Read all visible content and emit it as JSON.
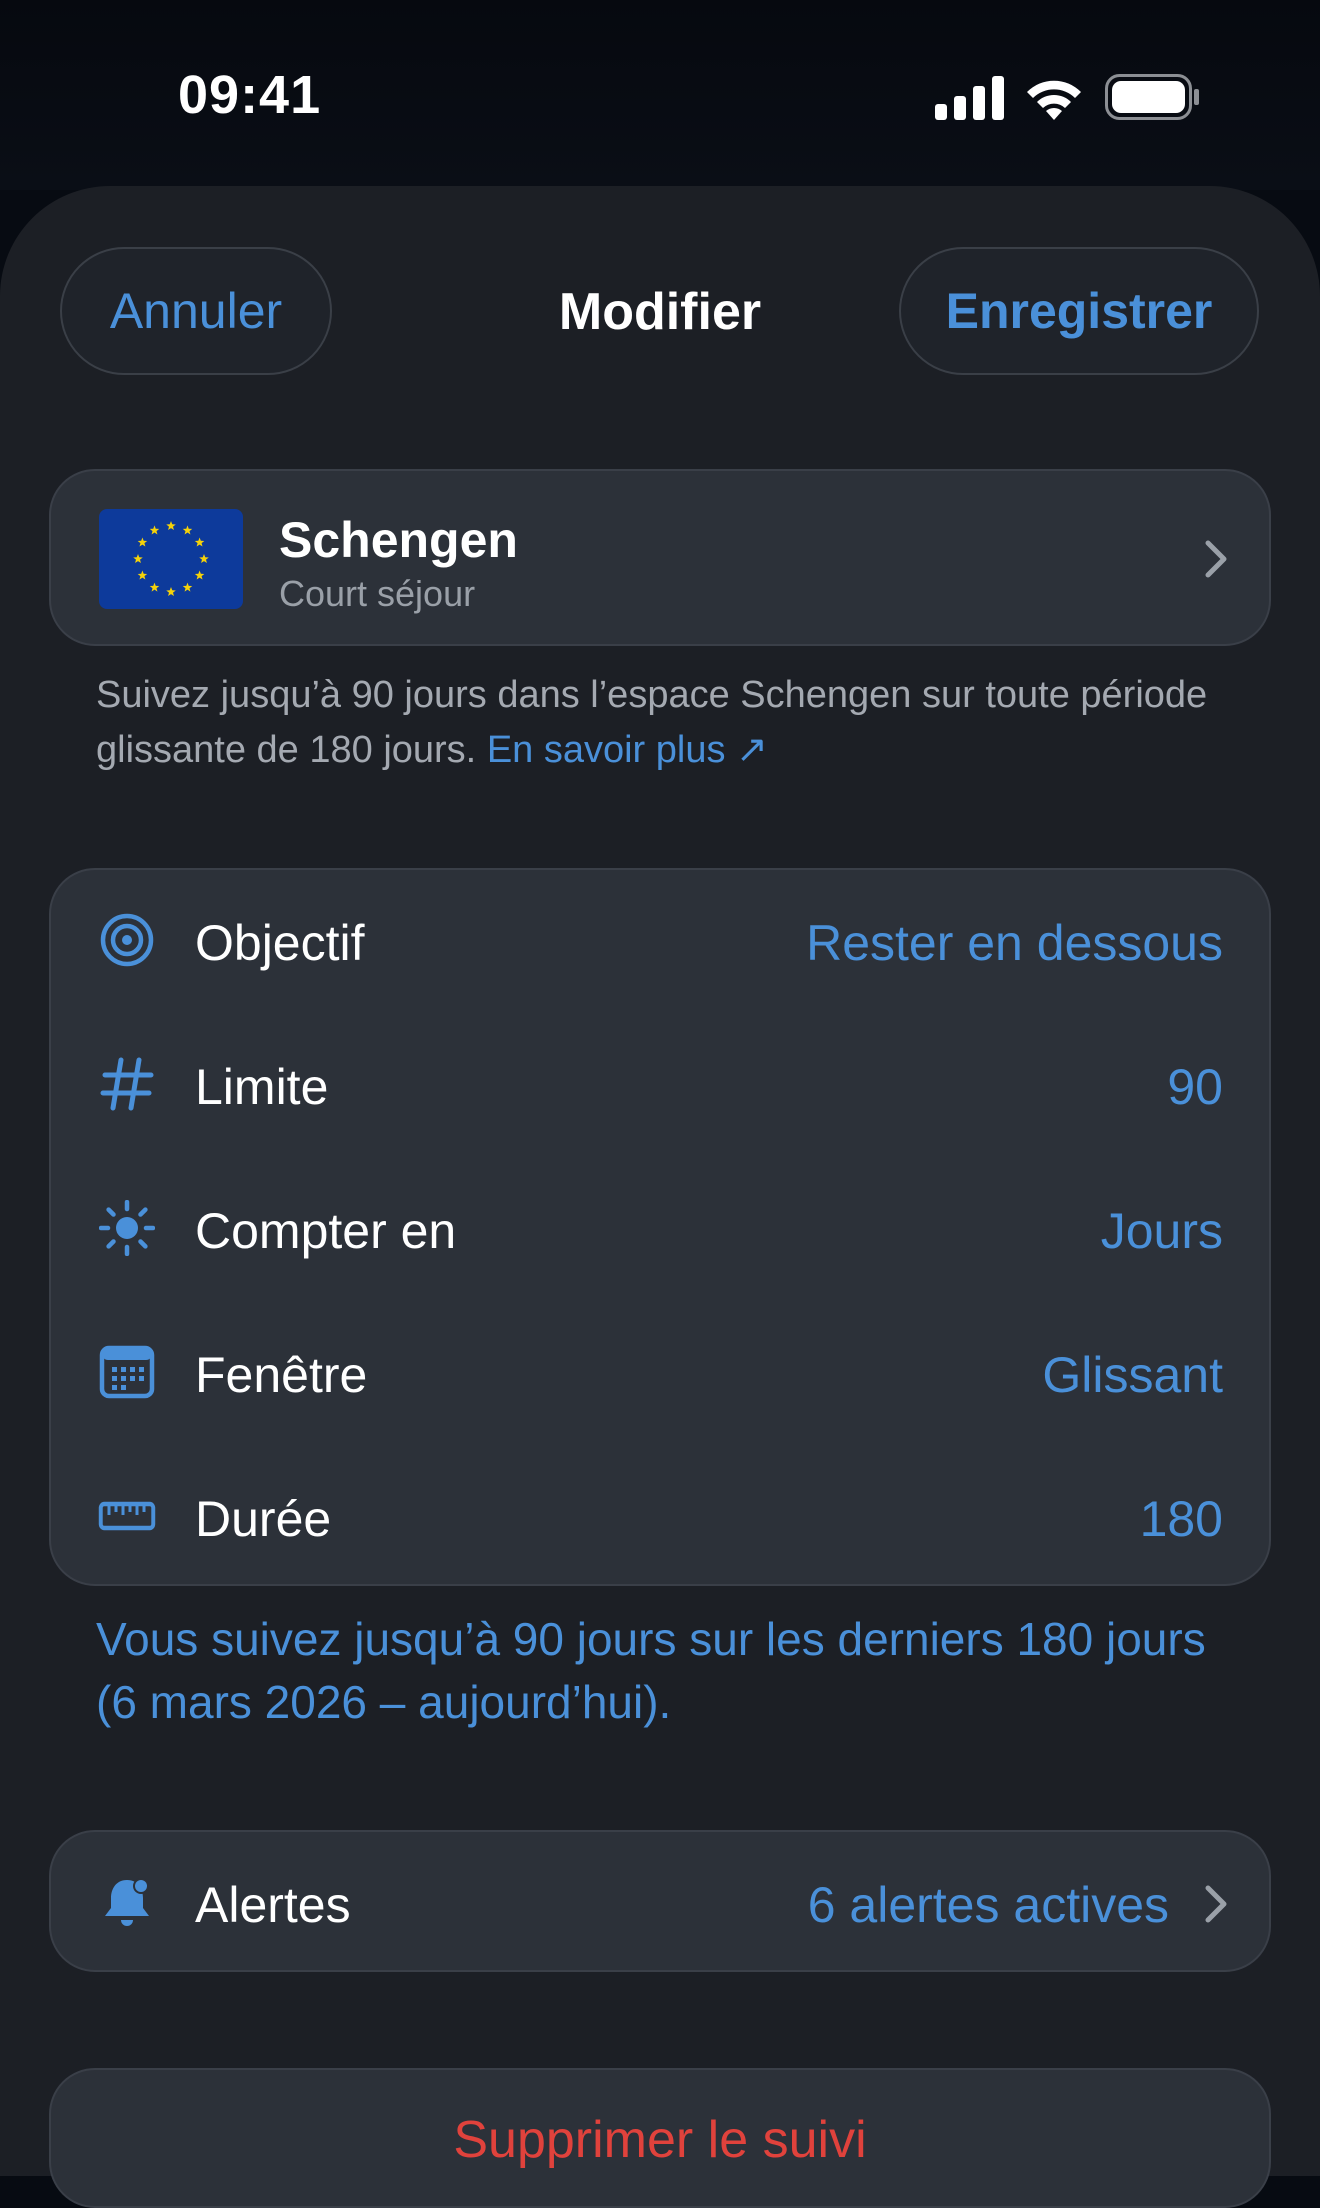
{
  "status_bar": {
    "time": "09:41",
    "icons": [
      "cellular-signal-icon",
      "wifi-icon",
      "battery-icon"
    ]
  },
  "nav": {
    "cancel_label": "Annuler",
    "title": "Modifier",
    "save_label": "Enregistrer"
  },
  "zone": {
    "flag_icon": "eu-flag-icon",
    "name": "Schengen",
    "subtitle": "Court séjour",
    "description": "Suivez jusqu’à 90 jours dans l’espace Schengen sur toute période glissante de 180 jours.",
    "link_label": "En savoir plus ↗"
  },
  "settings": [
    {
      "icon": "target-icon",
      "label": "Objectif",
      "value": "Rester en dessous"
    },
    {
      "icon": "hash-icon",
      "label": "Limite",
      "value": "90"
    },
    {
      "icon": "sun-icon",
      "label": "Compter en",
      "value": "Jours"
    },
    {
      "icon": "calendar-icon",
      "label": "Fenêtre",
      "value": "Glissant"
    },
    {
      "icon": "ruler-icon",
      "label": "Durée",
      "value": "180"
    }
  ],
  "summary": "Vous suivez jusqu’à 90 jours sur les derniers 180 jours (6 mars 2026 – aujourd’hui).",
  "alerts": {
    "icon": "bell-badge-icon",
    "label": "Alertes",
    "value": "6 alertes actives"
  },
  "delete_label": "Supprimer le suivi",
  "colors": {
    "accent": "#4a90d9",
    "destructive": "#e0423c",
    "background": "#1c1f25",
    "card": "#2c3139"
  }
}
